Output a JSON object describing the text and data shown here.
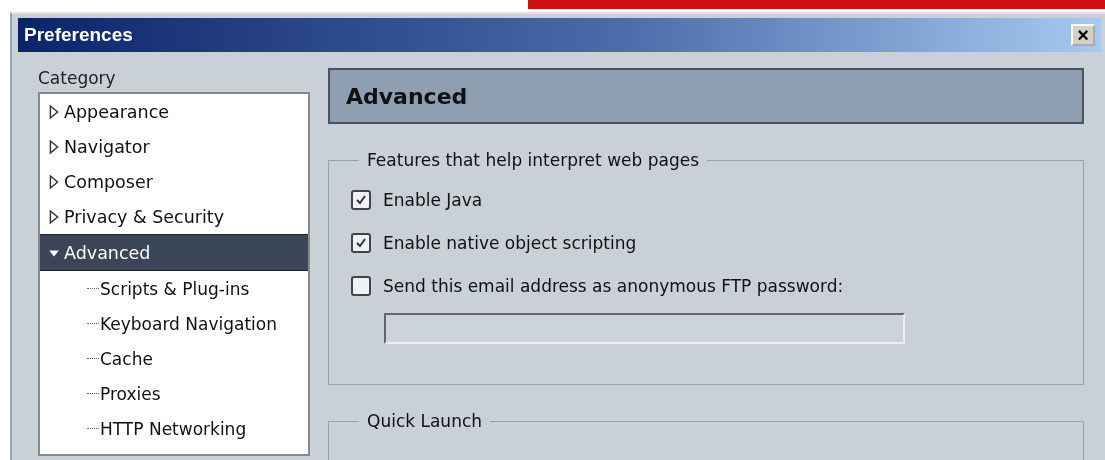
{
  "window": {
    "title": "Preferences",
    "close_button": "×"
  },
  "category": {
    "label": "Category",
    "items": [
      {
        "label": "Appearance",
        "expanded": false,
        "selected": false
      },
      {
        "label": "Navigator",
        "expanded": false,
        "selected": false
      },
      {
        "label": "Composer",
        "expanded": false,
        "selected": false
      },
      {
        "label": "Privacy & Security",
        "expanded": false,
        "selected": false
      },
      {
        "label": "Advanced",
        "expanded": true,
        "selected": true,
        "children": [
          {
            "label": "Scripts & Plug-ins",
            "selected": false
          },
          {
            "label": "Keyboard Navigation",
            "selected": false
          },
          {
            "label": "Cache",
            "selected": false
          },
          {
            "label": "Proxies",
            "selected": false
          },
          {
            "label": "HTTP Networking",
            "selected": false
          }
        ]
      }
    ]
  },
  "panel": {
    "title": "Advanced",
    "groups": [
      {
        "legend": "Features that help interpret web pages",
        "options": [
          {
            "label": "Enable Java",
            "checked": true
          },
          {
            "label": "Enable native object scripting",
            "checked": true
          },
          {
            "label": "Send this email address as anonymous FTP password:",
            "checked": false
          }
        ],
        "has_field": true
      },
      {
        "legend": "Quick Launch"
      }
    ]
  }
}
